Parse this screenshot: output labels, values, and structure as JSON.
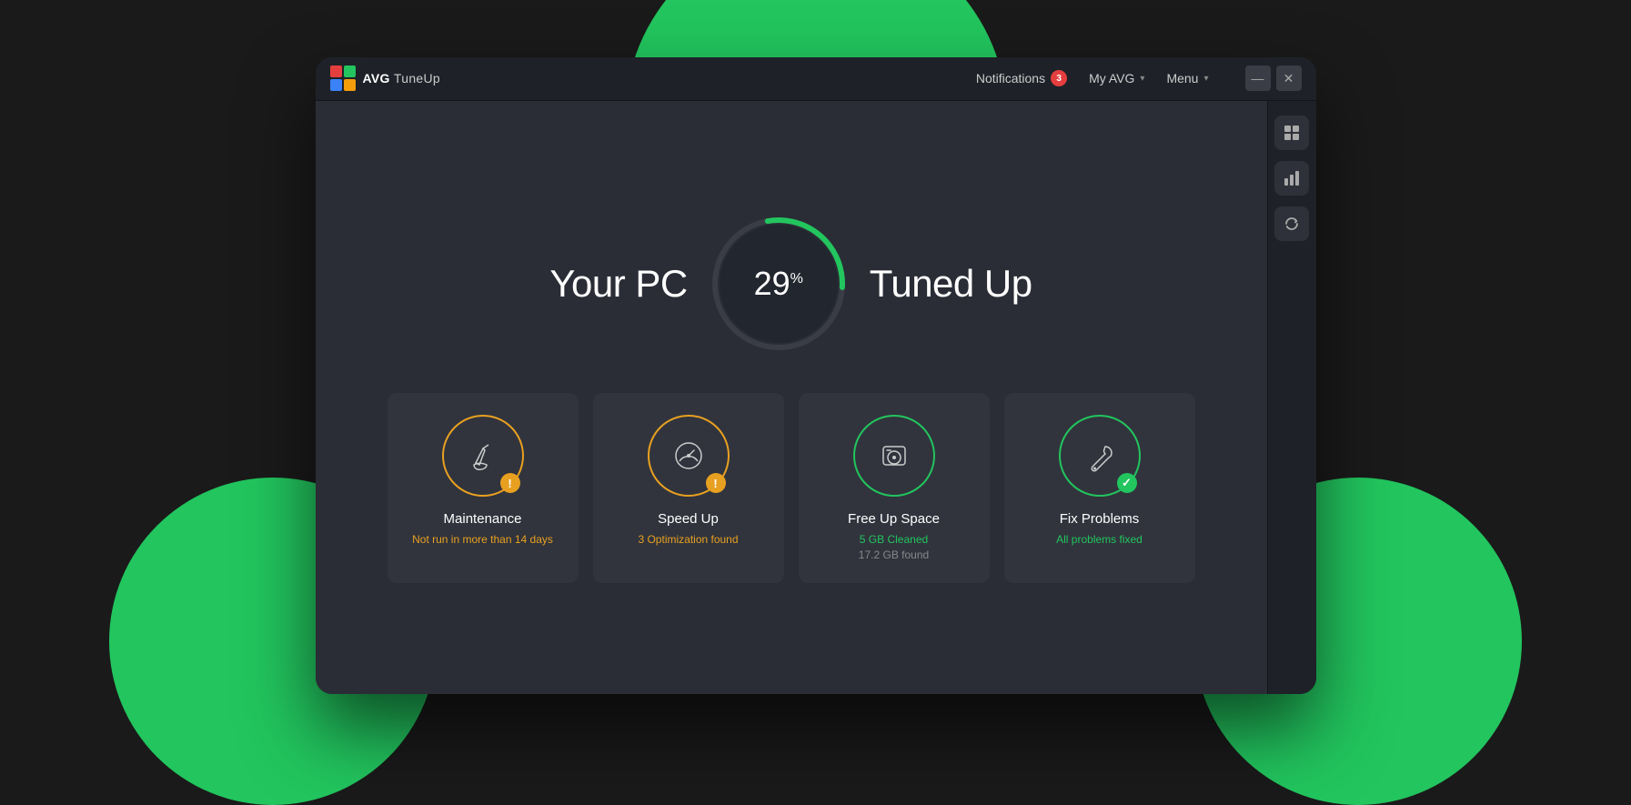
{
  "app": {
    "logo_avg": "AVG",
    "logo_sep": " ",
    "logo_tuneup": "TuneUp"
  },
  "titlebar": {
    "notifications_label": "Notifications",
    "notifications_count": "3",
    "my_avg_label": "My AVG",
    "menu_label": "Menu"
  },
  "hero": {
    "left_text": "Your PC",
    "right_text": "Tuned Up",
    "percent": "29",
    "percent_symbol": "%"
  },
  "cards": [
    {
      "id": "maintenance",
      "title": "Maintenance",
      "status": "Not run in more than 14 days",
      "status_type": "warning",
      "icon": "🧹",
      "badge": "!",
      "badge_type": "warning",
      "border_type": "warning"
    },
    {
      "id": "speedup",
      "title": "Speed Up",
      "status": "3 Optimization found",
      "status_type": "warning",
      "icon": "⚡",
      "badge": "!",
      "badge_type": "warning",
      "border_type": "warning"
    },
    {
      "id": "freespace",
      "title": "Free Up Space",
      "status_line1": "5 GB Cleaned",
      "status_line2": "17.2 GB found",
      "status_type": "mixed",
      "icon": "💾",
      "border_type": "green"
    },
    {
      "id": "fixproblems",
      "title": "Fix Problems",
      "status": "All problems fixed",
      "status_type": "success",
      "icon": "🔧",
      "badge": "✓",
      "badge_type": "success",
      "border_type": "green"
    }
  ],
  "sidebar_icons": [
    "⊞",
    "▦",
    "↺"
  ]
}
